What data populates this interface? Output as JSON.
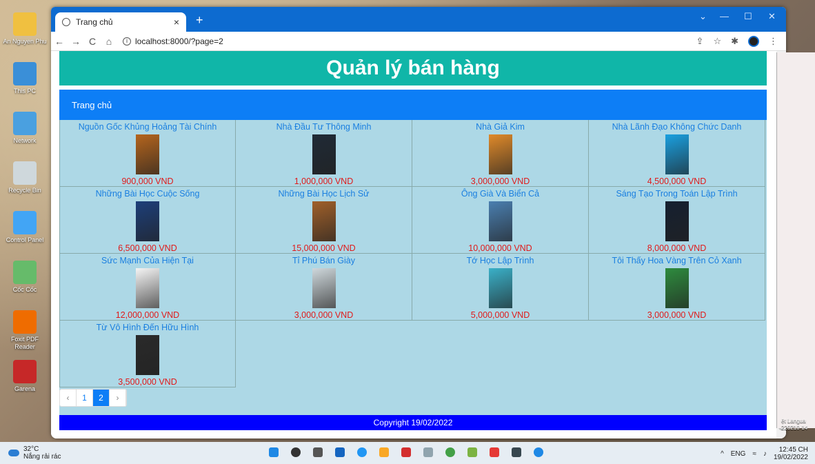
{
  "browser": {
    "tab_title": "Trang chủ",
    "new_tab": "+",
    "close_tab": "×",
    "url": "localhost:8000/?page=2",
    "window_controls": [
      "⌄",
      "—",
      "☐",
      "✕"
    ]
  },
  "desktop_icons": [
    {
      "label": "An Nguyen Phu"
    },
    {
      "label": "This PC"
    },
    {
      "label": "Network"
    },
    {
      "label": "Recycle Bin"
    },
    {
      "label": "Control Panel"
    },
    {
      "label": "Cốc Cốc"
    },
    {
      "label": "Foxit PDF Reader"
    },
    {
      "label": "Garena"
    }
  ],
  "page": {
    "title": "Quản lý bán hàng",
    "nav_home": "Trang chủ",
    "footer": "Copyright 19/02/2022"
  },
  "products": [
    {
      "name": "Nguồn Gốc Khủng Hoảng Tài Chính",
      "price": "900,000 VND",
      "cover_color": "#b5651d"
    },
    {
      "name": "Nhà Đầu Tư Thông Minh",
      "price": "1,000,000 VND",
      "cover_color": "#1f2a36"
    },
    {
      "name": "Nhà Giả Kim",
      "price": "3,000,000 VND",
      "cover_color": "#e08a2a"
    },
    {
      "name": "Nhà Lãnh Đạo Không Chức Danh",
      "price": "4,500,000 VND",
      "cover_color": "#1aa0e0"
    },
    {
      "name": "Những Bài Học Cuộc Sống",
      "price": "6,500,000 VND",
      "cover_color": "#1d3f7a"
    },
    {
      "name": "Những Bài Học Lịch Sử",
      "price": "15,000,000 VND",
      "cover_color": "#a0602a"
    },
    {
      "name": "Ông Già Và Biển Cả",
      "price": "10,000,000 VND",
      "cover_color": "#4a7fb0"
    },
    {
      "name": "Sáng Tạo Trong Toán Lập Trình",
      "price": "8,000,000 VND",
      "cover_color": "#152030"
    },
    {
      "name": "Sức Mạnh Của Hiện Tại",
      "price": "12,000,000 VND",
      "cover_color": "#f5f5f5"
    },
    {
      "name": "Tỉ Phú Bán Giày",
      "price": "3,000,000 VND",
      "cover_color": "#cfd8dc"
    },
    {
      "name": "Tớ Học Lập Trình",
      "price": "5,000,000 VND",
      "cover_color": "#3ab0c8"
    },
    {
      "name": "Tôi Thấy Hoa Vàng Trên Cỏ Xanh",
      "price": "3,000,000 VND",
      "cover_color": "#2e8b3e"
    },
    {
      "name": "Từ Vô Hình Đến Hữu Hình",
      "price": "3,500,000 VND",
      "cover_color": "#2a2a2a"
    }
  ],
  "pagination": {
    "prev": "‹",
    "pages": [
      "1",
      "2"
    ],
    "active": "2",
    "next": "›"
  },
  "taskbar": {
    "temperature": "32°C",
    "weather": "Nắng rải rác",
    "language": "ENG",
    "time": "12:45 CH",
    "date": "19/02/2022"
  },
  "side_window": {
    "text1": "ệt Langua",
    "text2": "220210-14"
  }
}
